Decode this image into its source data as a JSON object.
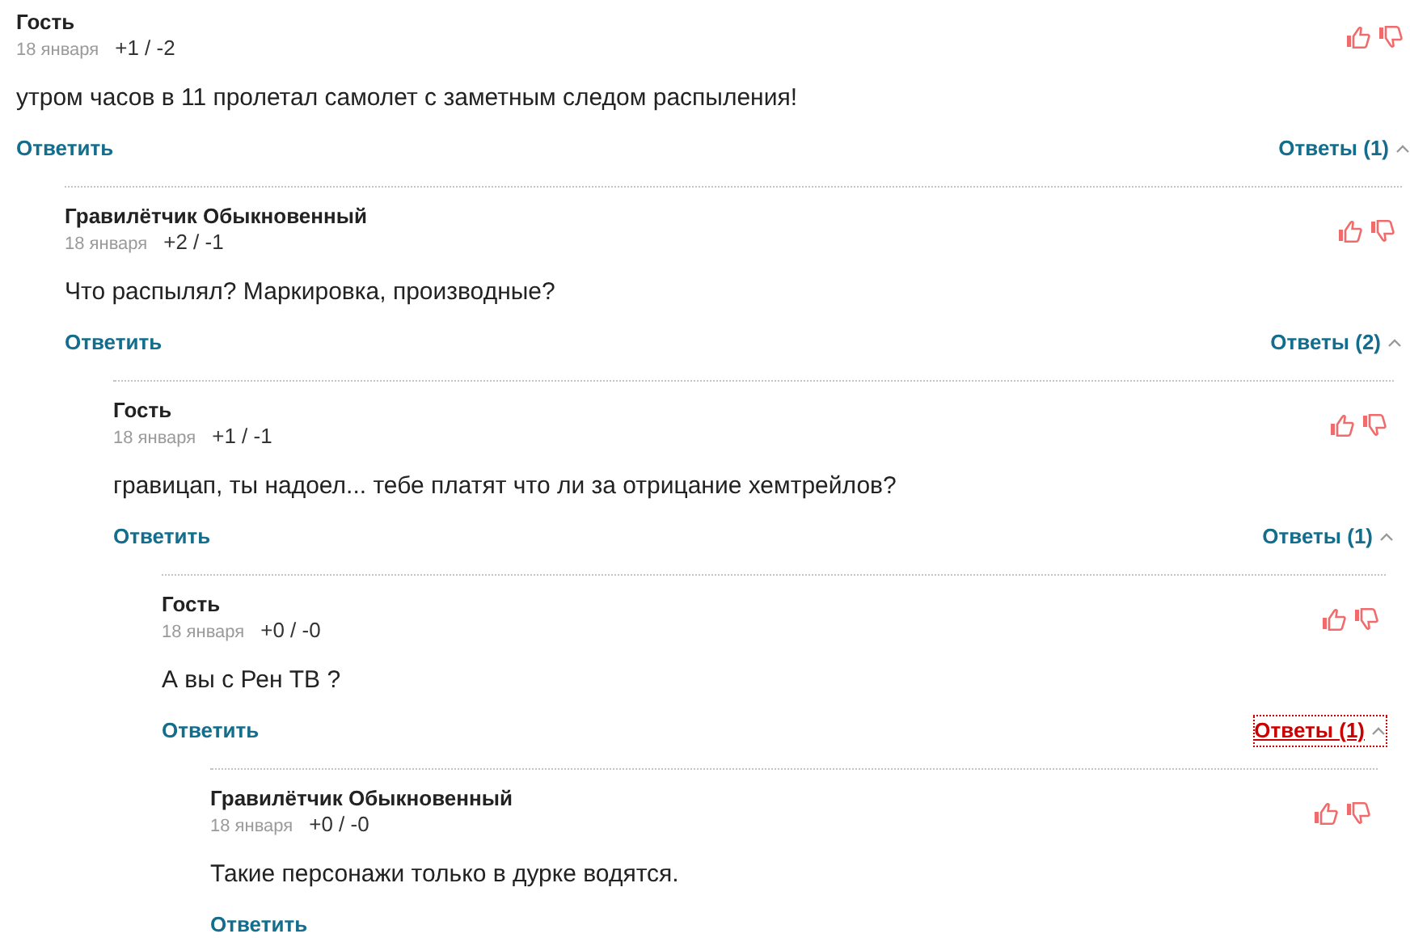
{
  "comments": [
    {
      "author": "Гость",
      "date": "18 января",
      "votes": "+1 / -2",
      "text": "утром часов в 11 пролетал самолет с заметным следом распыления!",
      "reply": "Ответить",
      "replies": {
        "label": "Ответы (1)",
        "expanded": true,
        "focused": false
      },
      "children": [
        {
          "author": "Гравилётчик Обыкновенный",
          "date": "18 января",
          "votes": "+2 / -1",
          "text": "Что распылял? Маркировка, производные?",
          "reply": "Ответить",
          "replies": {
            "label": "Ответы (2)",
            "expanded": true,
            "focused": false
          },
          "children": [
            {
              "author": "Гость",
              "date": "18 января",
              "votes": "+1 / -1",
              "text": "гравицап, ты надоел... тебе платят что ли за отрицание хемтрейлов?",
              "reply": "Ответить",
              "replies": {
                "label": "Ответы (1)",
                "expanded": true,
                "focused": false
              },
              "children": [
                {
                  "author": "Гость",
                  "date": "18 января",
                  "votes": "+0 / -0",
                  "text": "А вы с Рен ТВ ?",
                  "reply": "Ответить",
                  "replies": {
                    "label": "Ответы (1)",
                    "expanded": true,
                    "focused": true
                  },
                  "children": [
                    {
                      "author": "Гравилётчик Обыкновенный",
                      "date": "18 января",
                      "votes": "+0 / -0",
                      "text": "Такие персонажи только в дурке водятся.",
                      "reply": "Ответить"
                    }
                  ]
                }
              ]
            }
          ]
        }
      ]
    }
  ]
}
